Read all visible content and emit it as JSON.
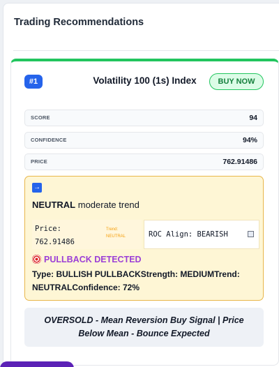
{
  "panel": {
    "title": "Trading Recommendations"
  },
  "card": {
    "rank": "#1",
    "symbol": "Volatility 100 (1s) Index",
    "action": "BUY NOW",
    "metrics": [
      {
        "label": "SCORE",
        "value": "94"
      },
      {
        "label": "CONFIDENCE",
        "value": "94%"
      },
      {
        "label": "PRICE",
        "value": "762.91486"
      }
    ],
    "trend": {
      "direction_icon": "right-arrow-icon",
      "label": "NEUTRAL",
      "strength": "moderate trend",
      "price_label": "Price:",
      "price_value": "762.91486",
      "mini_trend_label": "Trend:",
      "mini_trend_value": "NEUTRAL",
      "roc_align": "ROC Align: BEARISH",
      "pullback_title": "PULLBACK DETECTED",
      "pullback_details": "Type: BULLISH PULLBACKStrength: MEDIUMTrend: NEUTRALConfidence: 72%"
    },
    "signal": "OVERSOLD - Mean Reversion Buy Signal | Price Below Mean - Bounce Expected"
  },
  "colors": {
    "accent_green": "#22c55e",
    "rank_blue": "#2563eb",
    "trend_bg": "#fef6d5",
    "trend_border": "#e8b64a",
    "pullback_purple": "#9b3fd6"
  }
}
